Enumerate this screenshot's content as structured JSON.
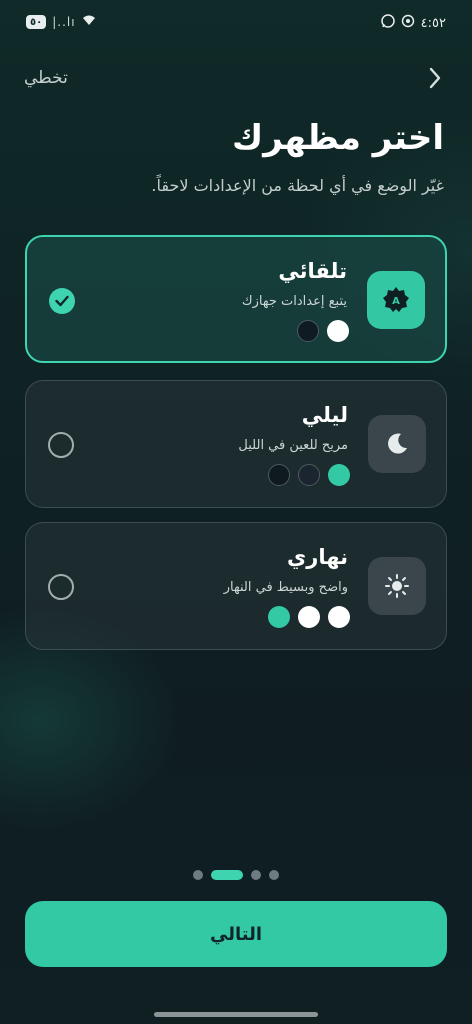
{
  "status_bar": {
    "battery": "٥٠",
    "signal_text": "|..lı",
    "time": "٤:٥٢"
  },
  "header": {
    "skip_label": "تخطي"
  },
  "title": "اختر مظهرك",
  "subtitle": "غيّر الوضع في أي لحظة من الإعدادات لاحقاً.",
  "options": [
    {
      "name": "تلقائي",
      "description": "يتبع إعدادات جهازك",
      "icon": "auto-theme-icon",
      "selected": true,
      "swatches": [
        "#ffffff",
        "#0f1b22"
      ]
    },
    {
      "name": "ليلي",
      "description": "مريح للعين في الليل",
      "icon": "moon-icon",
      "selected": false,
      "swatches": [
        "#34c9a5",
        "#1a2530",
        "#0f1a20"
      ]
    },
    {
      "name": "نهاري",
      "description": "واضح وبسيط في النهار",
      "icon": "sun-icon",
      "selected": false,
      "swatches": [
        "#34c9a5",
        "#ffffff",
        "#ffffff"
      ]
    }
  ],
  "pager": {
    "total": 4,
    "active_index": 1
  },
  "next_label": "التالي",
  "colors": {
    "accent": "#34c9a5",
    "selected_border": "#3fd4b0",
    "background": "#0f2224"
  }
}
